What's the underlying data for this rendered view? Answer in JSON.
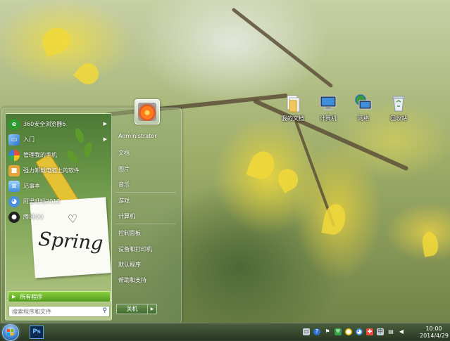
{
  "desktop": {
    "icons": [
      {
        "label": "我的文档",
        "icon": "documents-folder-icon"
      },
      {
        "label": "计算机",
        "icon": "computer-icon"
      },
      {
        "label": "网络",
        "icon": "network-icon"
      },
      {
        "label": "回收站",
        "icon": "recycle-bin-icon"
      }
    ]
  },
  "start_menu": {
    "programs": [
      {
        "label": "360安全浏览器6",
        "icon": "360-browser-icon",
        "has_arrow": true
      },
      {
        "label": "入门",
        "icon": "getting-started-icon",
        "has_arrow": true
      },
      {
        "label": "管理我的手机",
        "icon": "phone-manager-icon",
        "has_arrow": false
      },
      {
        "label": "强力卸载电脑上的软件",
        "icon": "uninstall-icon",
        "has_arrow": false
      },
      {
        "label": "记事本",
        "icon": "notepad-icon",
        "has_arrow": false
      },
      {
        "label": "阿里旺旺2013",
        "icon": "aliwangwang-icon",
        "has_arrow": false
      },
      {
        "label": "腾讯QQ",
        "icon": "qq-penguin-icon",
        "has_arrow": false
      }
    ],
    "note_text": "Spring",
    "all_programs_label": "所有程序",
    "search_placeholder": "搜索程序和文件",
    "user_name": "Administrator",
    "right_items": [
      "文档",
      "图片",
      "音乐",
      "游戏",
      "计算机",
      "控制面板",
      "设备和打印机",
      "默认程序",
      "帮助和支持"
    ],
    "shutdown_label": "关机"
  },
  "taskbar": {
    "pinned_app_label": "Ps",
    "tray_icons": [
      "keyboard-icon",
      "help-icon",
      "flag-icon",
      "shield-icon",
      "qq-tray-icon",
      "wangwang-tray-icon",
      "antivirus-icon",
      "input-method-icon",
      "network-tray-icon",
      "volume-icon"
    ],
    "clock_time": "10:00",
    "clock_date": "2014/4/29"
  },
  "colors": {
    "taskbar": "#2f4428",
    "all_programs_accent": "#5da526",
    "ps_blue": "#0b2a4e"
  }
}
